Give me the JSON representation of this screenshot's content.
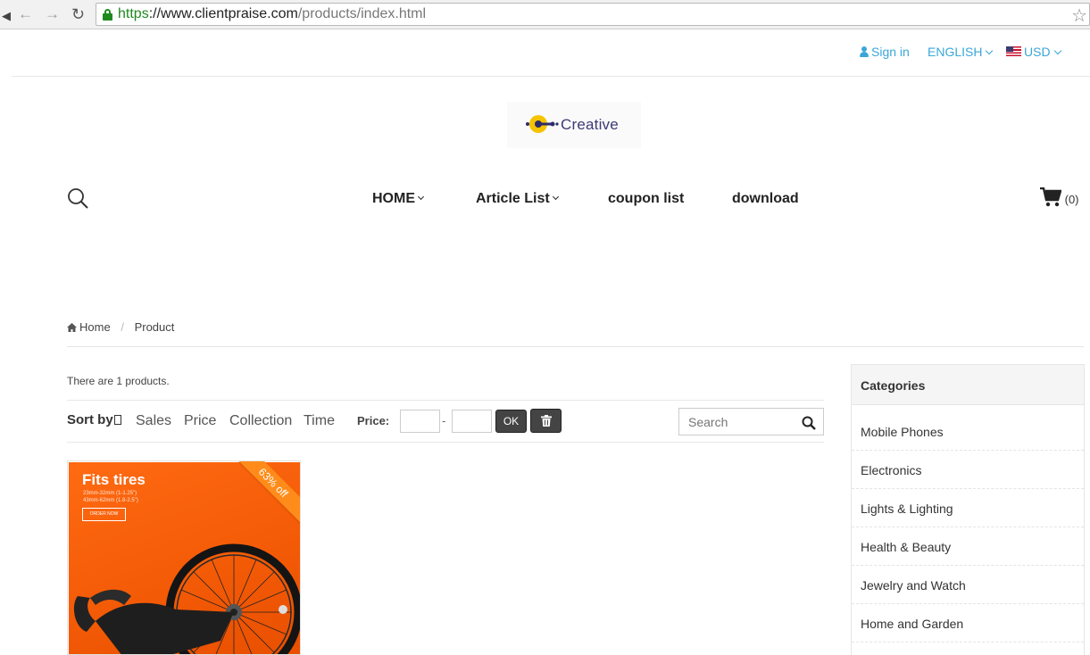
{
  "browser": {
    "url_scheme": "https",
    "url_host": "://www.clientpraise.com",
    "url_path": "/products/index.html"
  },
  "topbar": {
    "signin": "Sign in",
    "language": "ENGLISH",
    "currency": "USD"
  },
  "logo": {
    "text": "Creative"
  },
  "nav": {
    "home": "HOME",
    "article_list": "Article List",
    "coupon_list": "coupon list",
    "download": "download",
    "cart_count": "(0)"
  },
  "breadcrumb": {
    "home": "Home",
    "current": "Product"
  },
  "products": {
    "count_text": "There are 1 products.",
    "sort_label": "Sort by",
    "sort_options": [
      "Sales",
      "Price",
      "Collection",
      "Time"
    ],
    "price_label": "Price:",
    "price_dash": "-",
    "ok_label": "OK",
    "search_placeholder": "Search"
  },
  "product_card": {
    "headline": "Fits tires",
    "line1": "23mm-32mm (1-1.25\")",
    "line2": "43mm-62mm (1.8-2.5\")",
    "button": "ORDER NOW",
    "discount": "63% off"
  },
  "sidebar": {
    "title": "Categories",
    "categories": [
      "Mobile Phones",
      "Electronics",
      "Lights & Lighting",
      "Health & Beauty",
      "Jewelry and Watch",
      "Home and Garden"
    ]
  },
  "colors": {
    "link_blue": "#3aa7d8",
    "ribbon_orange": "#ff8c1a",
    "product_bg": "#f35a06",
    "button_dark": "#444444"
  }
}
